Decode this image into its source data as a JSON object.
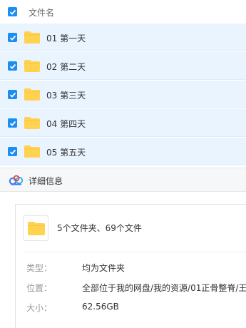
{
  "header": {
    "column_label": "文件名",
    "select_all_checked": true
  },
  "rows": [
    {
      "name": "01 第一天",
      "checked": true
    },
    {
      "name": "02 第二天",
      "checked": true
    },
    {
      "name": "03 第三天",
      "checked": true
    },
    {
      "name": "04 第四天",
      "checked": true
    },
    {
      "name": "05 第五天",
      "checked": true
    }
  ],
  "detail": {
    "title": "详细信息",
    "summary": "5个文件夹、69个文件",
    "fields": [
      {
        "key": "类型：",
        "value": "均为文件夹"
      },
      {
        "key": "位置：",
        "value": "全部位于我的网盘/我的资源/01正骨整脊/王"
      },
      {
        "key": "大小：",
        "value": "62.56GB"
      }
    ]
  },
  "colors": {
    "accent": "#1d8ef0",
    "row_selected_bg": "#e9f4ff",
    "folder": "#ffd24f"
  }
}
